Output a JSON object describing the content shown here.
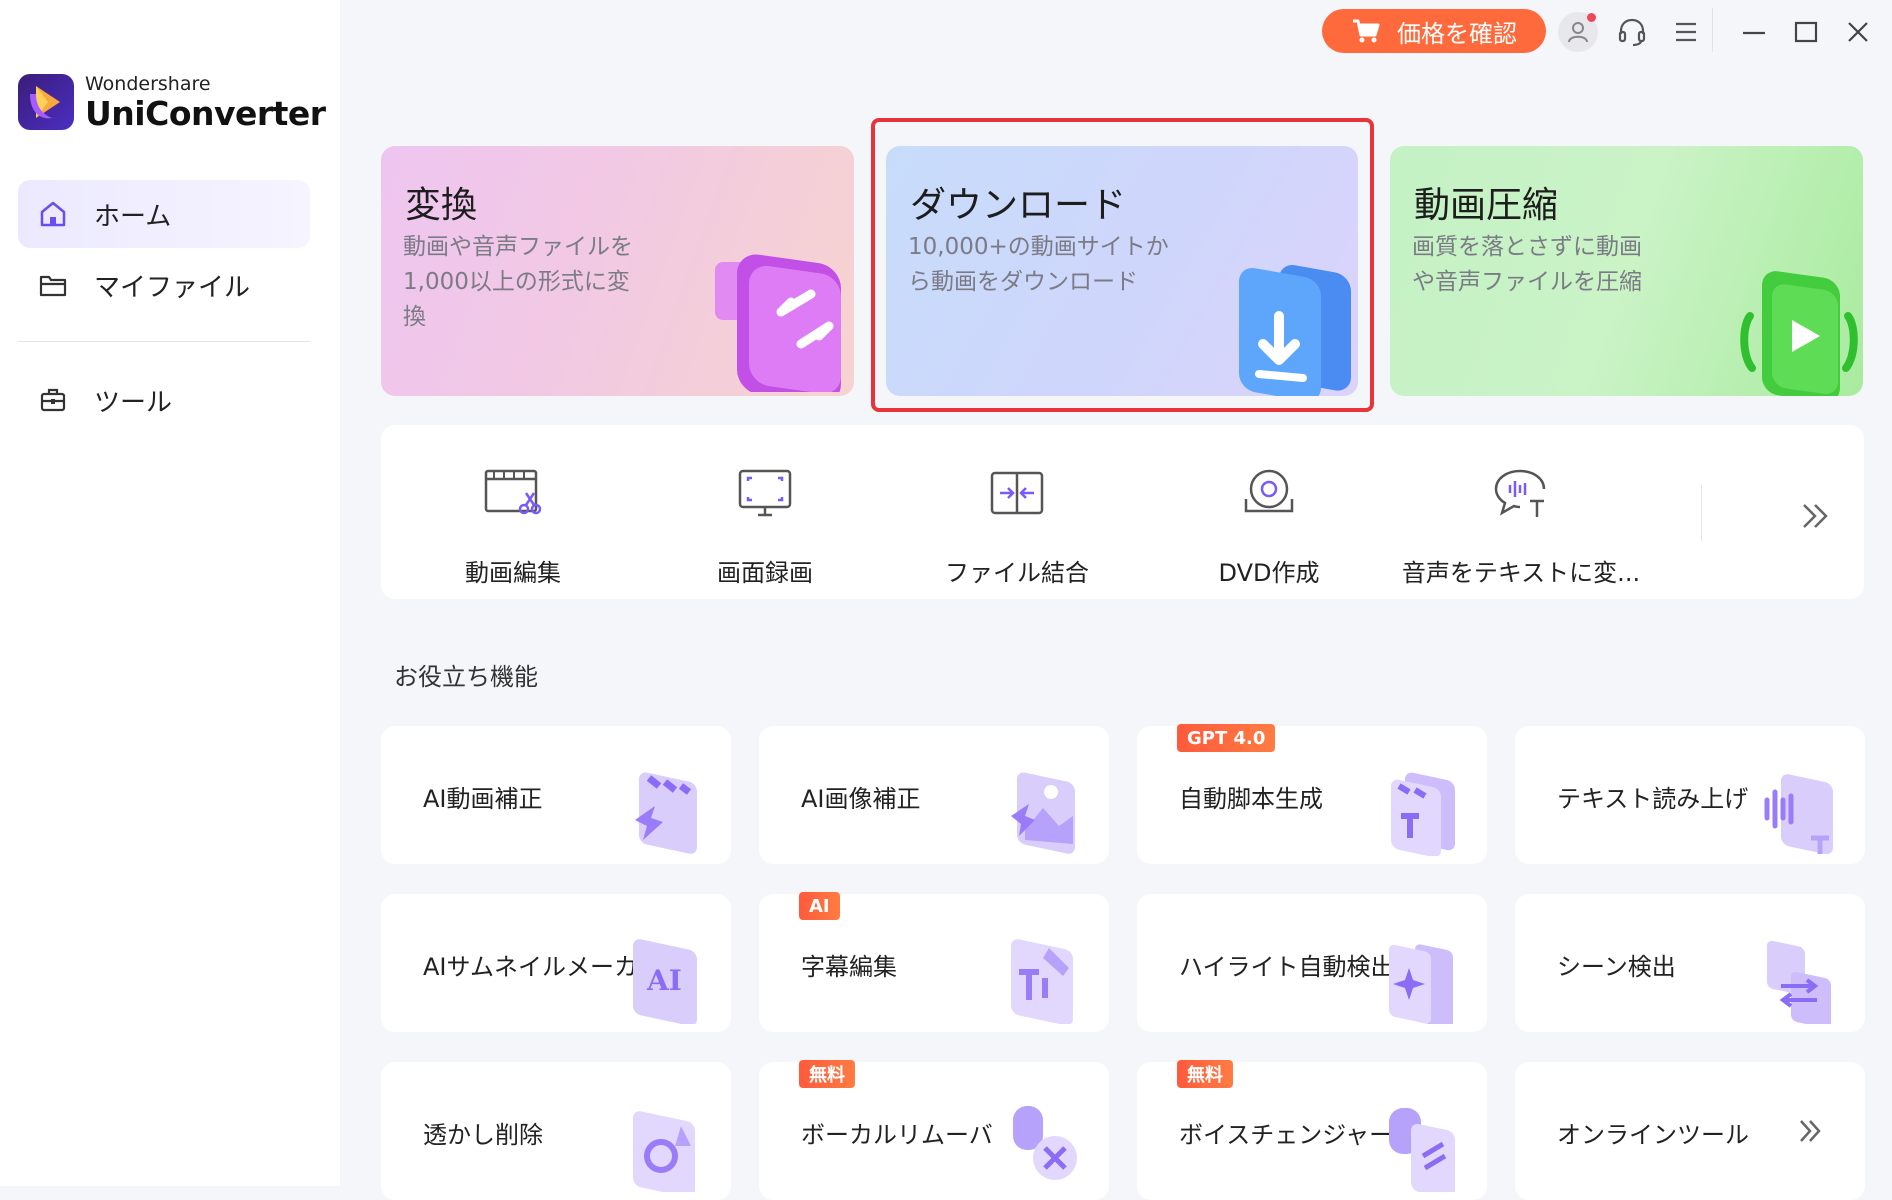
{
  "app": {
    "brand_sub": "Wondershare",
    "brand_main": "UniConverter"
  },
  "sidebar": {
    "items": [
      {
        "label": "ホーム",
        "icon": "home-icon",
        "active": true
      },
      {
        "label": "マイファイル",
        "icon": "folder-icon",
        "active": false
      },
      {
        "label": "ツール",
        "icon": "toolbox-icon",
        "active": false
      }
    ]
  },
  "topbar": {
    "price_label": "価格を確認",
    "icons": [
      "cart-icon",
      "user-icon",
      "headset-icon",
      "menu-icon",
      "minimize-icon",
      "maximize-icon",
      "close-icon"
    ]
  },
  "hero": [
    {
      "title": "変換",
      "desc": [
        "動画や音声ファイルを",
        "1,000以上の形式に変",
        "換"
      ]
    },
    {
      "title": "ダウンロード",
      "desc": [
        "10,000+の動画サイトか",
        "ら動画をダウンロード"
      ]
    },
    {
      "title": "動画圧縮",
      "desc": [
        "画質を落とさずに動画",
        "や音声ファイルを圧縮"
      ]
    }
  ],
  "tools": [
    {
      "label": "動画編集",
      "icon": "video-edit-icon"
    },
    {
      "label": "画面録画",
      "icon": "screen-record-icon"
    },
    {
      "label": "ファイル結合",
      "icon": "merge-icon"
    },
    {
      "label": "DVD作成",
      "icon": "dvd-icon"
    },
    {
      "label": "音声をテキストに変...",
      "icon": "speech-to-text-icon"
    }
  ],
  "section_title": "お役立ち機能",
  "features": [
    {
      "label": "AI動画補正",
      "badge": ""
    },
    {
      "label": "AI画像補正",
      "badge": ""
    },
    {
      "label": "自動脚本生成",
      "badge": "GPT 4.0"
    },
    {
      "label": "テキスト読み上げ",
      "badge": ""
    },
    {
      "label": "AIサムネイルメーカー",
      "badge": ""
    },
    {
      "label": "字幕編集",
      "badge": "AI"
    },
    {
      "label": "ハイライト自動検出",
      "badge": ""
    },
    {
      "label": "シーン検出",
      "badge": ""
    },
    {
      "label": "透かし削除",
      "badge": ""
    },
    {
      "label": "ボーカルリムーバ",
      "badge": "無料"
    },
    {
      "label": "ボイスチェンジャー",
      "badge": "無料"
    },
    {
      "label": "オンラインツール",
      "badge": ""
    }
  ],
  "colors": {
    "accent": "#6b4cf0",
    "price_button": "#ff6a3d",
    "highlight_border": "#e8333b"
  }
}
